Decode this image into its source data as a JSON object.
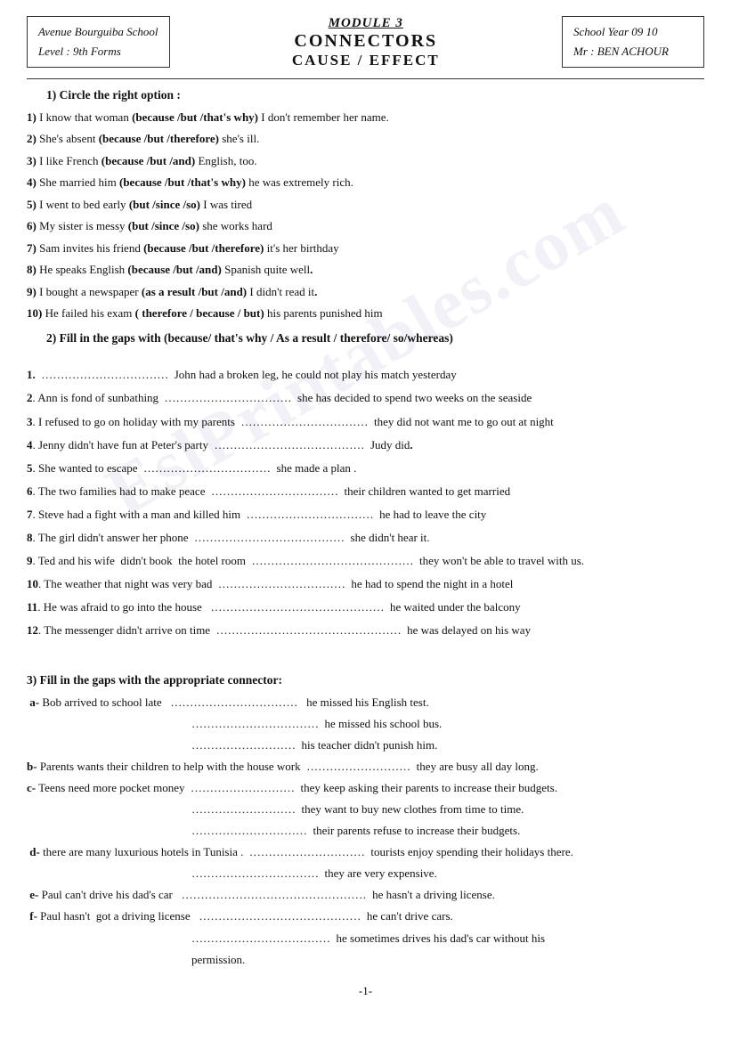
{
  "header": {
    "left_line1": "Avenue Bourguiba School",
    "left_line2": "Level : 9th Forms",
    "center_line1": "MODULE 3",
    "center_line2": "CONNECTORS",
    "center_line3": "CAUSE / EFFECT",
    "right_line1": "School Year 09 10",
    "right_line2": "Mr : BEN ACHOUR"
  },
  "exercise1": {
    "title": "1) Circle the right option :",
    "items": [
      "1) I know that woman (because /but /that's why) I don't remember her name.",
      "2) She's absent (because /but /therefore) she's ill.",
      "3) I like French (because /but /and)  English, too.",
      "4) She married him (because /but /that's why)  he was extremely rich.",
      "5) I went to bed early (but /since /so) I was tired",
      "6) My sister is messy (but /since /so) she works hard",
      "7) Sam invites his friend (because /but /therefore)  it's her birthday",
      "8) He speaks English (because /but /and)   Spanish quite well.",
      "9) I bought a newspaper (as a result /but /and)   I didn't read it.",
      "10) He failed his exam ( therefore / because / but) his parents punished him"
    ]
  },
  "exercise2": {
    "title": "2) Fill in the gaps with  (because/ that's why / As a result / therefore/ so/whereas)",
    "items": [
      "1.  ………………………  John had a broken leg, he could not play his match yesterday",
      "2. Ann is fond of sunbathing  …………………… she has decided to spend two weeks on the seaside",
      "3. I refused to go on holiday with my parents ……………………  they did not want me to go out at night",
      "4. Jenny didn't have fun at Peter's party ………………………Judy did.",
      "5. She wanted to escape ………………………  she made a plan .",
      "6. The two families had to make peace ………………………their children wanted to get married",
      "7. Steve had a fight with a man and killed him ………………………  he had to leave the city",
      "8. The girl didn't answer her phone …………………………… she didn't hear it.",
      "9. Ted and his wife  didn't book  the hotel room ……………………………  they won't be able to travel with us.",
      "10. The weather that night was very bad …………………………… he had to spend the night in a hotel",
      "11. He was afraid to go into the house  ……………………………………  he waited under the balcony",
      "12. The messenger didn't arrive on time ………………………………………  he was delayed on his way"
    ]
  },
  "exercise3": {
    "title": "3) Fill in the gaps with the appropriate connector:",
    "sections": [
      {
        "label": "a-",
        "main": "Bob arrived to school late   ……………………………  he missed his English test.",
        "sub": [
          "……………………………  he missed his school bus.",
          "………………………  his teacher didn't punish him."
        ]
      },
      {
        "label": "b-",
        "main": "Parents wants their children to help with the house work  ………………………  they are busy all day long.",
        "sub": []
      },
      {
        "label": "c-",
        "main": "Teens need more pocket money  ………………………  they keep asking their parents to increase their budgets.",
        "sub": [
          "………………………  they want to buy new clothes from time to time.",
          "…………………………  their parents refuse to increase their budgets."
        ]
      },
      {
        "label": "d-",
        "main": "there are many luxurious hotels in Tunisia . …………………………tourists enjoy spending their holidays there.",
        "sub": [
          "……………………………  they are very expensive."
        ]
      },
      {
        "label": "e-",
        "main": "Paul can't drive his dad's car  ………………………………………  he hasn't a driving license.",
        "sub": []
      },
      {
        "label": "f-",
        "main": "Paul hasn't  got a driving license  ……………………………………  he can't drive cars.",
        "sub": [
          "………………………………  he sometimes drives his dad's car without his permission."
        ]
      }
    ]
  },
  "page_number": "-1-",
  "watermark": "EslPrintables.com"
}
